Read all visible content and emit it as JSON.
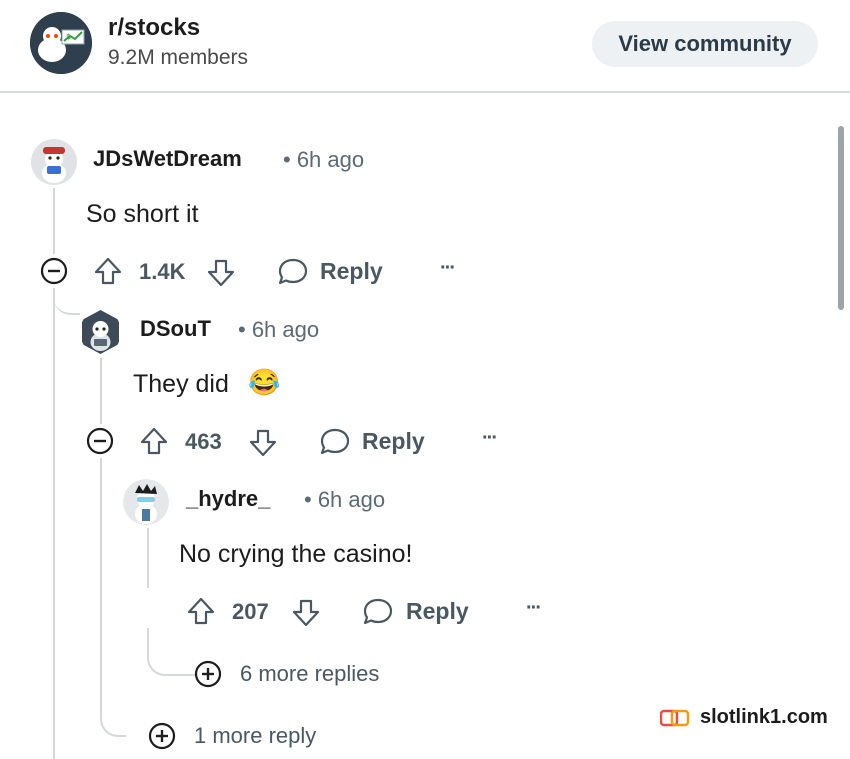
{
  "header": {
    "community_name": "r/stocks",
    "members": "9.2M members",
    "view_button": "View community"
  },
  "comments": [
    {
      "username": "JDsWetDream",
      "time": "• 6h ago",
      "body": "So short it",
      "votes": "1.4K",
      "reply_label": "Reply",
      "more_label": "···"
    },
    {
      "username": "DSouT",
      "time": "• 6h ago",
      "body": "They did",
      "emoji": "😂",
      "votes": "463",
      "reply_label": "Reply",
      "more_label": "···"
    },
    {
      "username": "_hydre_",
      "time": "• 6h ago",
      "body": "No crying the casino!",
      "votes": "207",
      "reply_label": "Reply",
      "more_label": "···"
    }
  ],
  "more_replies": [
    {
      "label": "6 more replies"
    },
    {
      "label": "1 more reply"
    }
  ],
  "watermark": "slotlink1.com",
  "colors": {
    "text": "#1c1c1c",
    "muted": "#4a5863",
    "button_bg": "#eef1f3",
    "thread_line": "#d4d8db",
    "avatar_dark": "#2f3f4e"
  }
}
